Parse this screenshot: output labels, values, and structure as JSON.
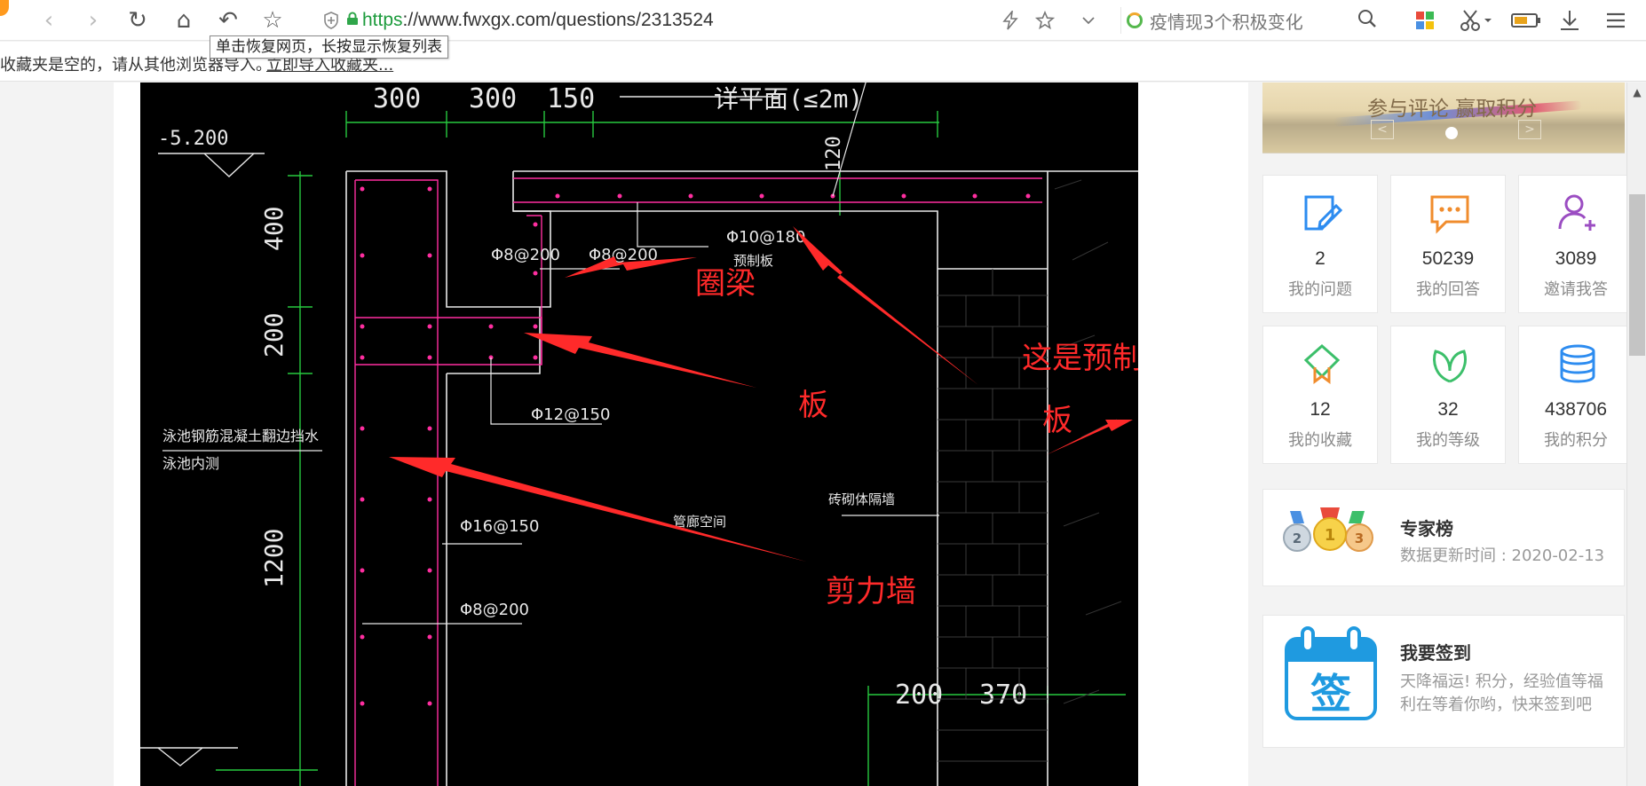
{
  "browser": {
    "nav": {
      "back": "‹",
      "forward": "›",
      "reload": "↻",
      "home": "⌂",
      "restore": "↶",
      "bookmark": "☆"
    },
    "url_scheme": "https",
    "url_rest": "://www.fwxgx.com/questions/2313524",
    "search_text": "疫情现3个积极变化",
    "tooltip": "单击恢复网页，长按显示恢复列表",
    "icons": {
      "shield": "shield-icon",
      "lock": "lock-icon",
      "flash": "flash-icon",
      "star": "star-icon",
      "chevron": "chevron-down-icon",
      "search": "search-icon",
      "apps": "apps-grid-icon",
      "scissors": "scissors-icon",
      "battery": "battery-icon",
      "download": "download-icon",
      "menu": "menu-icon"
    }
  },
  "bookmarks_bar": {
    "message": "收藏夹是空的，请从其他浏览器导入。",
    "import_link": "立即导入收藏夹..."
  },
  "drawing": {
    "dims_top": [
      "300",
      "300",
      "150"
    ],
    "detail_label": "详平面(≤2m)",
    "level": "-5.200",
    "dim_120": "120",
    "dims_left": [
      "400",
      "200",
      "1200"
    ],
    "rebar_labels": [
      "Φ8@200",
      "Φ8@200",
      "Φ10@180",
      "预制板",
      "Φ12@150",
      "Φ16@150",
      "Φ8@200",
      "管廊空间",
      "砖砌体隔墙"
    ],
    "pool_labels": [
      "泳池钢筋混凝土翻边挡水",
      "泳池内测"
    ],
    "dims_bottom": [
      "200",
      "370"
    ],
    "annotations": [
      "圈梁",
      "板",
      "这是预制构件，不用绘制的",
      "板",
      "剪力墙"
    ],
    "colors": {
      "background": "#000000",
      "dim_line": "#27c93f",
      "outline": "#e8e8e8",
      "rebar": "#ff2ea0",
      "annotation": "#ff2a2a"
    }
  },
  "sidebar": {
    "banner_title": "参与评论 赢取积分",
    "stats": [
      {
        "num": "2",
        "label": "我的问题",
        "icon": "edit-note-icon",
        "color": "#2d8cf0"
      },
      {
        "num": "50239",
        "label": "我的回答",
        "icon": "chat-bubble-icon",
        "color": "#f08c2d"
      },
      {
        "num": "3089",
        "label": "邀请我答",
        "icon": "add-user-icon",
        "color": "#9b4dc2"
      },
      {
        "num": "12",
        "label": "我的收藏",
        "icon": "bookmark-icon",
        "color": "#3cbf6a"
      },
      {
        "num": "32",
        "label": "我的等级",
        "icon": "leaf-icon",
        "color": "#3cbf6a"
      },
      {
        "num": "438706",
        "label": "我的积分",
        "icon": "coins-stack-icon",
        "color": "#2d8cf0"
      }
    ],
    "experts": {
      "title": "专家榜",
      "update": "数据更新时间 : 2020-02-13",
      "medals": [
        "1",
        "2",
        "3"
      ]
    },
    "signin": {
      "title": "我要签到",
      "desc": "天降福运! 积分，经验值等福利在等着你哟，快来签到吧",
      "badge": "签"
    }
  }
}
